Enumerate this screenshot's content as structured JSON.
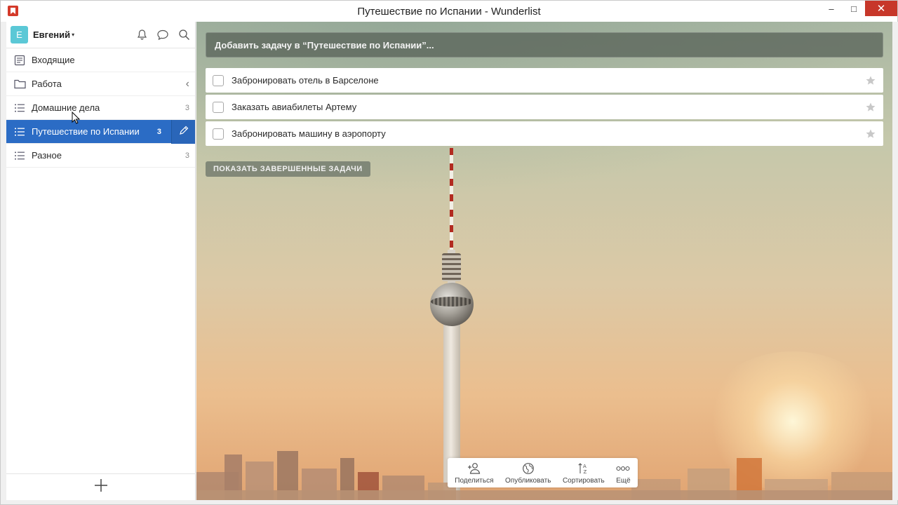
{
  "window": {
    "title": "Путешествие по Испании - Wunderlist",
    "controls": {
      "minimize": "‒",
      "maximize": "□",
      "close": "✕"
    }
  },
  "user": {
    "initial": "E",
    "name": "Евгений",
    "caret": "▾"
  },
  "sidebar": {
    "items": [
      {
        "label": "Входящие",
        "icon": "inbox-icon",
        "count": ""
      },
      {
        "label": "Работа",
        "icon": "folder-icon",
        "count": "",
        "chevron": "‹"
      },
      {
        "label": "Домашние дела",
        "icon": "list-icon",
        "count": "3"
      },
      {
        "label": "Путешествие по Испании",
        "icon": "list-icon",
        "count": "3",
        "active": true
      },
      {
        "label": "Разное",
        "icon": "list-icon",
        "count": "3"
      }
    ],
    "add_list_icon": "plus-icon"
  },
  "main": {
    "add_task_placeholder": "Добавить задачу в “Путешествие по Испании”...",
    "tasks": [
      {
        "title": "Забронировать отель в Барселоне",
        "done": false,
        "starred": false
      },
      {
        "title": "Заказать авиабилеты Артему",
        "done": false,
        "starred": false
      },
      {
        "title": "Забронировать машину в аэропорту",
        "done": false,
        "starred": false
      }
    ],
    "show_completed": "ПОКАЗАТЬ ЗАВЕРШЕННЫЕ ЗАДАЧИ",
    "toolbar": [
      {
        "label": "Поделиться",
        "icon": "share-person-icon"
      },
      {
        "label": "Опубликовать",
        "icon": "globe-icon"
      },
      {
        "label": "Сортировать",
        "icon": "sort-az-icon"
      },
      {
        "label": "Ещё",
        "icon": "more-dots-icon"
      }
    ]
  },
  "colors": {
    "accent": "#2b6cc5",
    "avatar": "#5bc8d6",
    "close_button": "#c7372a",
    "app_icon": "#d43a2a"
  }
}
